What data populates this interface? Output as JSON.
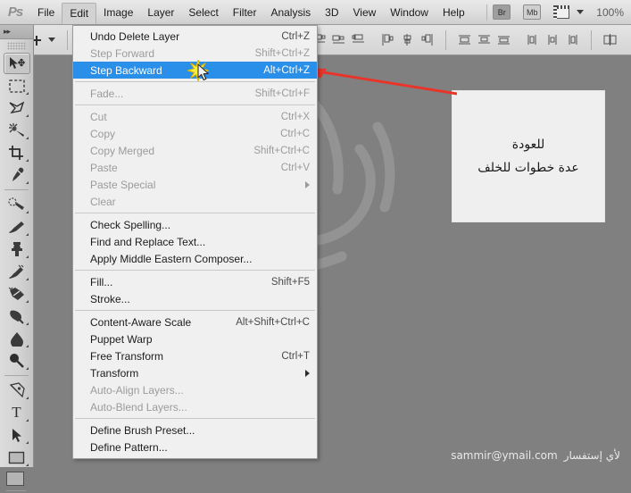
{
  "app": {
    "logo": "Ps",
    "zoom_level": "100%"
  },
  "menubar": {
    "items": [
      {
        "label": "File",
        "active": false
      },
      {
        "label": "Edit",
        "active": true
      },
      {
        "label": "Image",
        "active": false
      },
      {
        "label": "Layer",
        "active": false
      },
      {
        "label": "Select",
        "active": false
      },
      {
        "label": "Filter",
        "active": false
      },
      {
        "label": "Analysis",
        "active": false
      },
      {
        "label": "3D",
        "active": false
      },
      {
        "label": "View",
        "active": false
      },
      {
        "label": "Window",
        "active": false
      },
      {
        "label": "Help",
        "active": false
      }
    ],
    "bridge_button": "Br",
    "minibridge_button": "Mb",
    "view_icon": "screen-mode-icon",
    "caret_icon": "chevron-down-icon"
  },
  "optionsbar": {
    "tool_icon": "move-tool-icon",
    "tool_caret_icon": "chevron-down-icon",
    "auto_select_checkbox": "auto-select-checkbox",
    "align_icons": [
      "align-left-edges-icon",
      "align-horizontal-centers-icon",
      "align-right-edges-icon",
      "align-top-edges-icon",
      "align-vertical-centers-icon",
      "align-bottom-edges-icon",
      "distribute-top-edges-icon",
      "distribute-vertical-centers-icon",
      "distribute-bottom-edges-icon",
      "distribute-left-edges-icon",
      "distribute-horizontal-centers-icon",
      "distribute-right-edges-icon",
      "auto-align-layers-icon"
    ]
  },
  "toolbar": {
    "collapse_icon": "collapse-panel-icon",
    "tools": [
      {
        "name": "move-tool",
        "selected": true,
        "corner": false
      },
      {
        "name": "rectangular-marquee-tool",
        "selected": false,
        "corner": true
      },
      {
        "name": "lasso-tool",
        "selected": false,
        "corner": true
      },
      {
        "name": "quick-selection-tool",
        "selected": false,
        "corner": true
      },
      {
        "name": "crop-tool",
        "selected": false,
        "corner": true
      },
      {
        "name": "eyedropper-tool",
        "selected": false,
        "corner": true
      },
      {
        "name": "spot-healing-brush-tool",
        "selected": false,
        "corner": true
      },
      {
        "name": "brush-tool",
        "selected": false,
        "corner": true
      },
      {
        "name": "clone-stamp-tool",
        "selected": false,
        "corner": true
      },
      {
        "name": "history-brush-tool",
        "selected": false,
        "corner": true
      },
      {
        "name": "eraser-tool",
        "selected": false,
        "corner": true
      },
      {
        "name": "gradient-tool",
        "selected": false,
        "corner": true
      },
      {
        "name": "blur-tool",
        "selected": false,
        "corner": true
      },
      {
        "name": "dodge-tool",
        "selected": false,
        "corner": true
      },
      {
        "name": "pen-tool",
        "selected": false,
        "corner": true
      },
      {
        "name": "horizontal-type-tool",
        "selected": false,
        "corner": true
      },
      {
        "name": "path-selection-tool",
        "selected": false,
        "corner": true
      },
      {
        "name": "rectangle-tool",
        "selected": false,
        "corner": true
      }
    ],
    "foreground_color": "#b4b4b4"
  },
  "edit_menu": {
    "title": "Edit",
    "items": [
      {
        "label": "Undo Delete Layer",
        "shortcut": "Ctrl+Z",
        "disabled": false,
        "highlighted": false,
        "submenu": false
      },
      {
        "label": "Step Forward",
        "shortcut": "Shift+Ctrl+Z",
        "disabled": true,
        "highlighted": false,
        "submenu": false
      },
      {
        "label": "Step Backward",
        "shortcut": "Alt+Ctrl+Z",
        "disabled": false,
        "highlighted": true,
        "submenu": false
      },
      {
        "separator": true
      },
      {
        "label": "Fade...",
        "shortcut": "Shift+Ctrl+F",
        "disabled": true,
        "highlighted": false,
        "submenu": false
      },
      {
        "separator": true
      },
      {
        "label": "Cut",
        "shortcut": "Ctrl+X",
        "disabled": true,
        "highlighted": false,
        "submenu": false
      },
      {
        "label": "Copy",
        "shortcut": "Ctrl+C",
        "disabled": true,
        "highlighted": false,
        "submenu": false
      },
      {
        "label": "Copy Merged",
        "shortcut": "Shift+Ctrl+C",
        "disabled": true,
        "highlighted": false,
        "submenu": false
      },
      {
        "label": "Paste",
        "shortcut": "Ctrl+V",
        "disabled": true,
        "highlighted": false,
        "submenu": false
      },
      {
        "label": "Paste Special",
        "shortcut": "",
        "disabled": true,
        "highlighted": false,
        "submenu": true
      },
      {
        "label": "Clear",
        "shortcut": "",
        "disabled": true,
        "highlighted": false,
        "submenu": false
      },
      {
        "separator": true
      },
      {
        "label": "Check Spelling...",
        "shortcut": "",
        "disabled": false,
        "highlighted": false,
        "submenu": false
      },
      {
        "label": "Find and Replace Text...",
        "shortcut": "",
        "disabled": false,
        "highlighted": false,
        "submenu": false
      },
      {
        "label": "Apply Middle Eastern Composer...",
        "shortcut": "",
        "disabled": false,
        "highlighted": false,
        "submenu": false
      },
      {
        "separator": true
      },
      {
        "label": "Fill...",
        "shortcut": "Shift+F5",
        "disabled": false,
        "highlighted": false,
        "submenu": false
      },
      {
        "label": "Stroke...",
        "shortcut": "",
        "disabled": false,
        "highlighted": false,
        "submenu": false
      },
      {
        "separator": true
      },
      {
        "label": "Content-Aware Scale",
        "shortcut": "Alt+Shift+Ctrl+C",
        "disabled": false,
        "highlighted": false,
        "submenu": false
      },
      {
        "label": "Puppet Warp",
        "shortcut": "",
        "disabled": false,
        "highlighted": false,
        "submenu": false
      },
      {
        "label": "Free Transform",
        "shortcut": "Ctrl+T",
        "disabled": false,
        "highlighted": false,
        "submenu": false
      },
      {
        "label": "Transform",
        "shortcut": "",
        "disabled": false,
        "highlighted": false,
        "submenu": true
      },
      {
        "label": "Auto-Align Layers...",
        "shortcut": "",
        "disabled": true,
        "highlighted": false,
        "submenu": false
      },
      {
        "label": "Auto-Blend Layers...",
        "shortcut": "",
        "disabled": true,
        "highlighted": false,
        "submenu": false
      },
      {
        "separator": true
      },
      {
        "label": "Define Brush Preset...",
        "shortcut": "",
        "disabled": false,
        "highlighted": false,
        "submenu": false
      },
      {
        "label": "Define Pattern...",
        "shortcut": "",
        "disabled": false,
        "highlighted": false,
        "submenu": false
      }
    ],
    "cursor_icon": "mouse-pointer-icon",
    "click_burst_icon": "click-starburst-icon"
  },
  "callout": {
    "line1": "للعودة",
    "line2": "عدة خطوات للخلف",
    "arrow_icon": "red-pointer-arrow-icon",
    "arrow_color": "#e8352a",
    "background": "#efefef"
  },
  "footer": {
    "arabic_text": "لأي إستفسار",
    "email": "sammir@ymail.com"
  },
  "colors": {
    "canvas": "#808080",
    "menu_highlight": "#2a8fe8",
    "chrome": "#d6d6d6",
    "menu_bg": "#f0f0f0"
  }
}
